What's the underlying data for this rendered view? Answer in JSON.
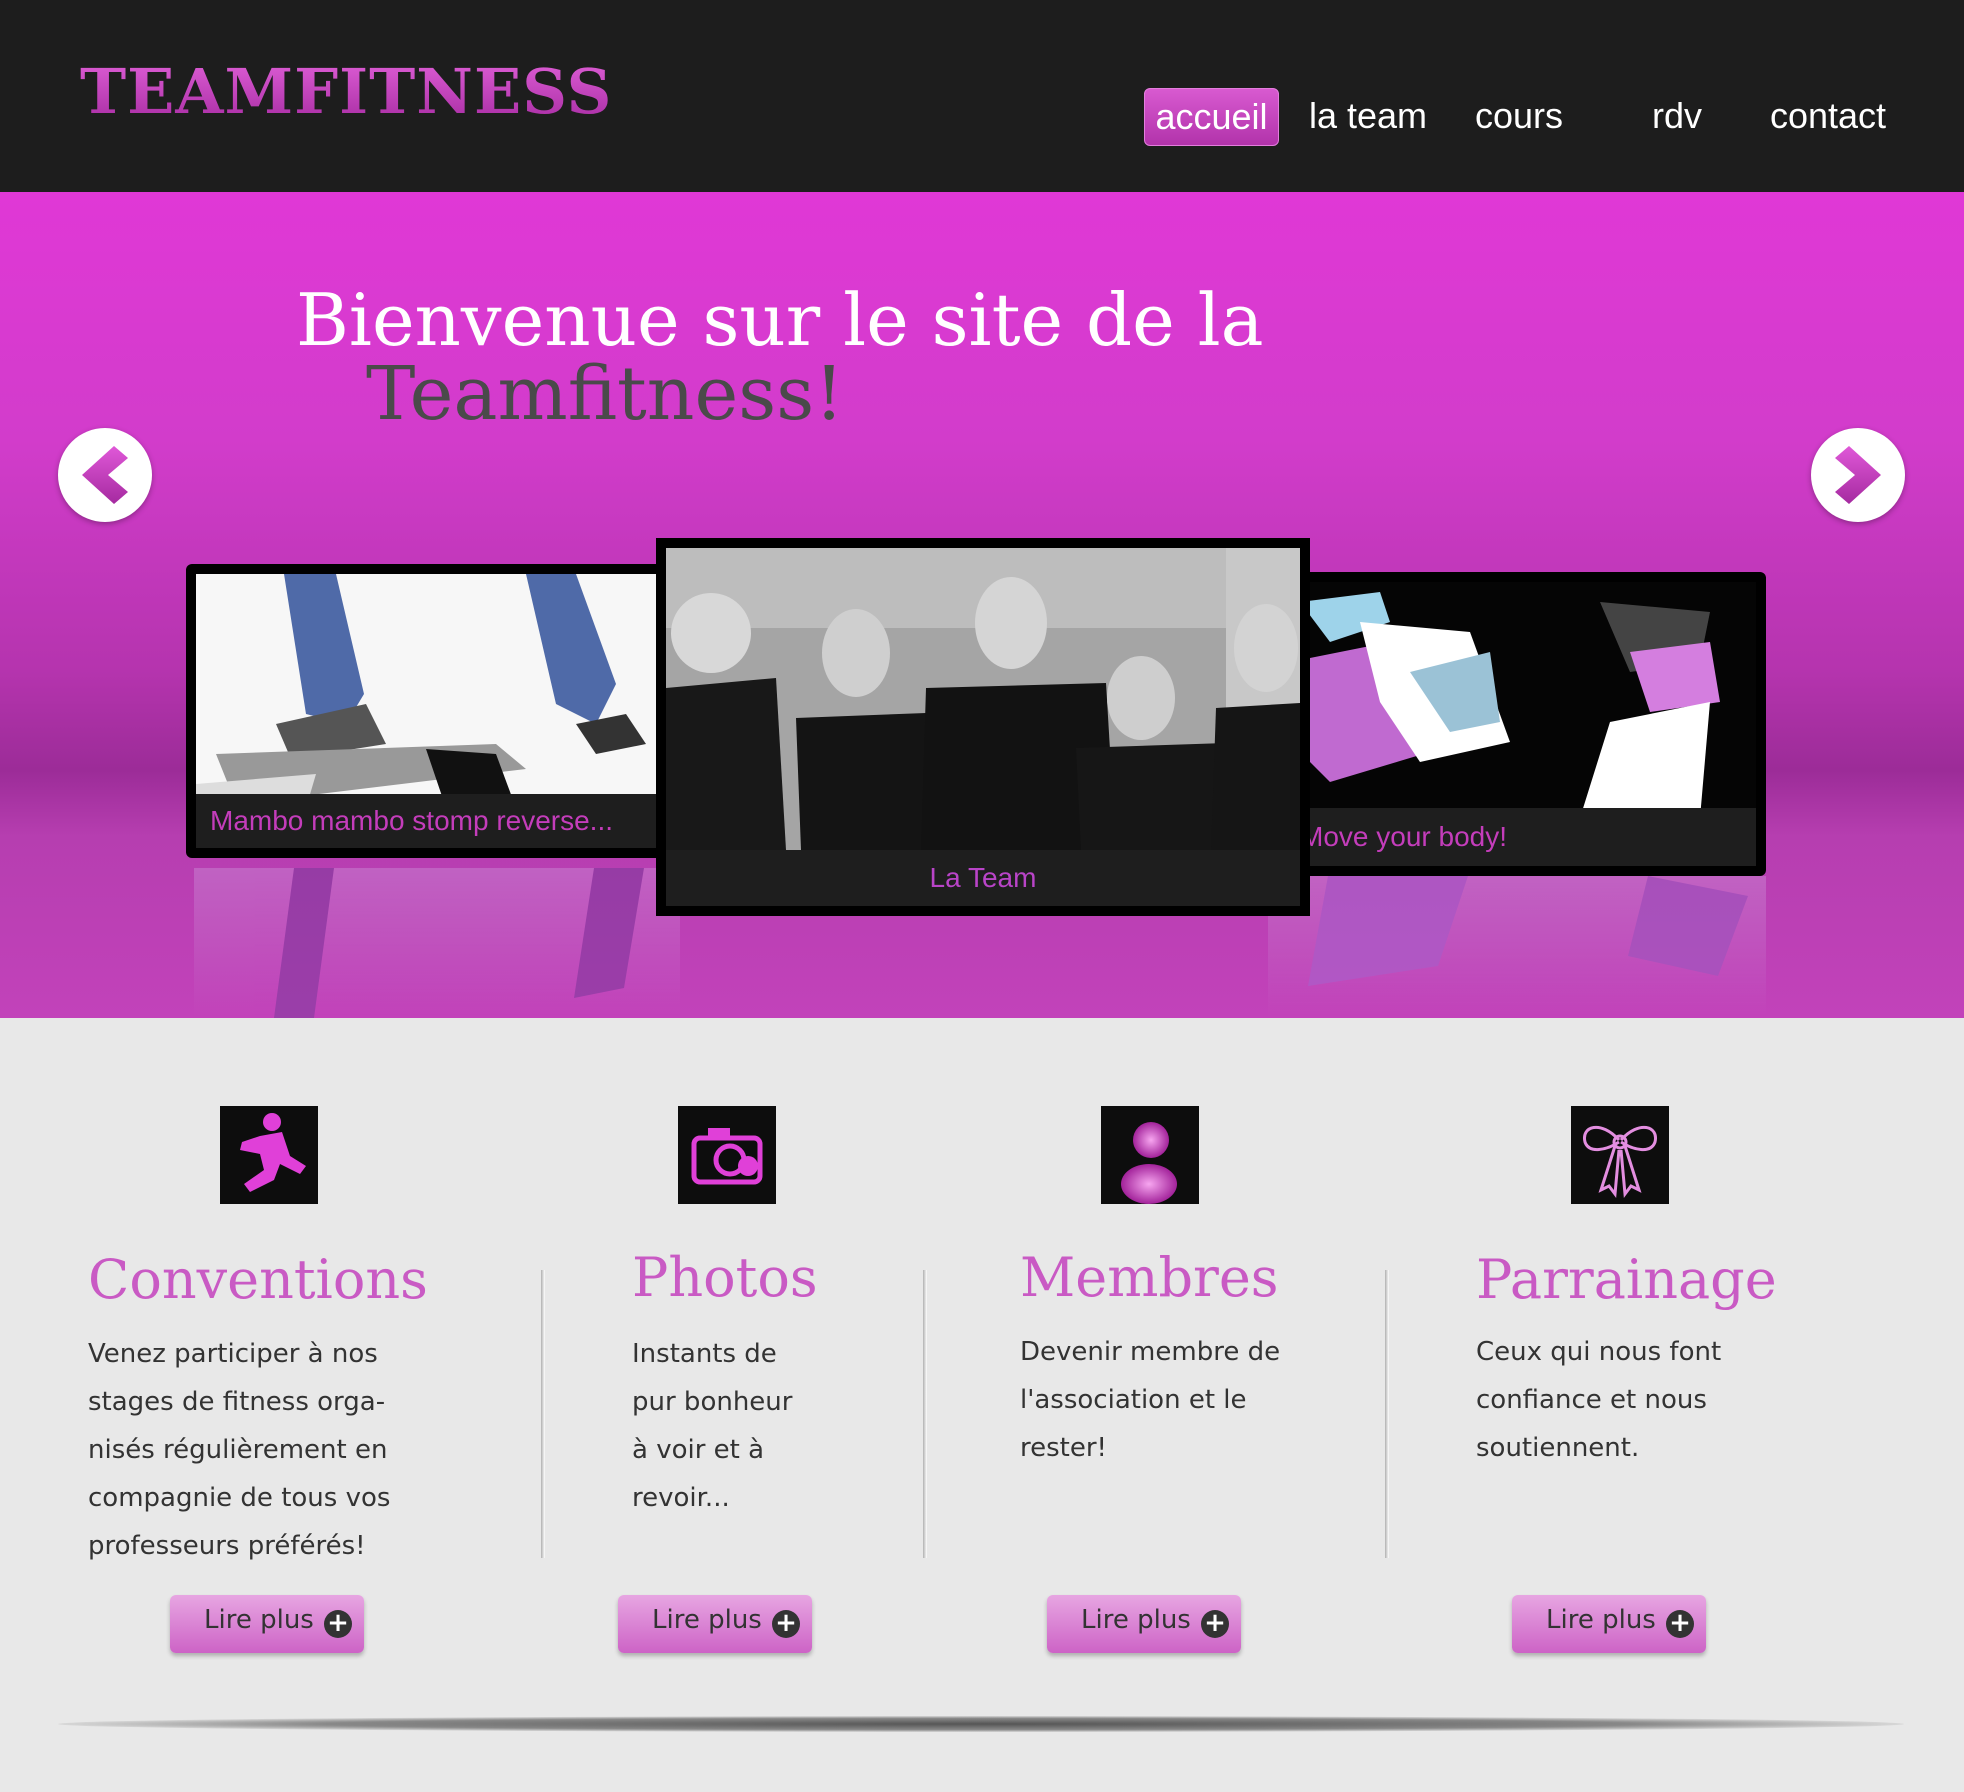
{
  "header": {
    "logo": "TEAMFITNESS",
    "nav": [
      {
        "label": "accueil",
        "active": true
      },
      {
        "label": "la team",
        "active": false
      },
      {
        "label": "cours",
        "active": false
      },
      {
        "label": "rdv",
        "active": false
      },
      {
        "label": "contact",
        "active": false
      }
    ]
  },
  "hero": {
    "title_line1": "Bienvenue sur le site de la",
    "title_line2": "Teamfitness!",
    "prev_icon": "chevron-left-icon",
    "next_icon": "chevron-right-icon",
    "slides": [
      {
        "caption": "Mambo mambo stomp reverse...",
        "image": "stepper-legs-photo"
      },
      {
        "caption": "La Team",
        "image": "team-group-photo"
      },
      {
        "caption": "Move your body!",
        "image": "dancer-photo"
      }
    ]
  },
  "features": [
    {
      "icon": "jumping-figure-icon",
      "title": "Conventions",
      "text": "Venez participer à nos\nstages de fitness orga-\nnisés régulièrement en\ncompagnie de tous vos\nprofesseurs préférés!",
      "button": "Lire plus"
    },
    {
      "icon": "camera-icon",
      "title": "Photos",
      "text": "Instants de\npur bonheur\nà voir et à\nrevoir...",
      "button": "Lire plus"
    },
    {
      "icon": "member-icon",
      "title": "Membres",
      "text": "Devenir membre de\nl'association et le\nrester!",
      "button": "Lire plus"
    },
    {
      "icon": "ribbon-bow-icon",
      "title": "Parrainage",
      "text": "Ceux qui nous font\nconfiance et nous\nsoutiennent.",
      "button": "Lire plus"
    }
  ],
  "colors": {
    "accent": "#c93dbf",
    "header_bg": "#1d1d1d",
    "hero_bg": "#d23ccb",
    "content_bg": "#e8e8e8"
  }
}
